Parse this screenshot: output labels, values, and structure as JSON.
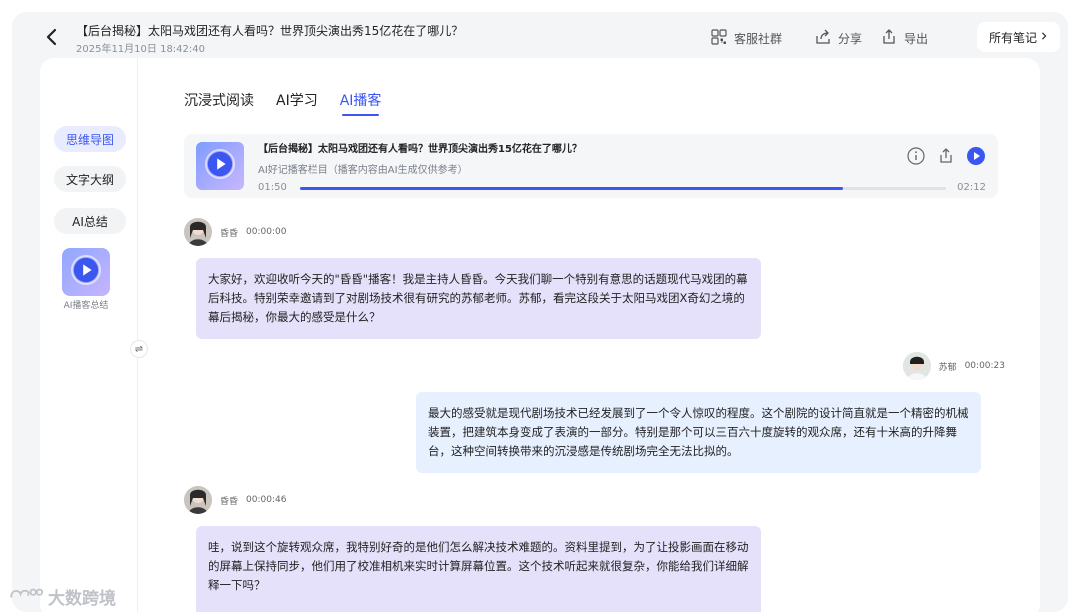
{
  "header": {
    "title": "【后台揭秘】太阳马戏团还有人看吗？世界顶尖演出秀15亿花在了哪儿？",
    "datetime": "2025年11月10日 18:42:40",
    "actions": {
      "community": "客服社群",
      "share": "分享",
      "export": "导出"
    },
    "all_notes": "所有笔记"
  },
  "sidebar": {
    "items": [
      {
        "label": "思维导图",
        "active": true
      },
      {
        "label": "文字大纲",
        "active": false
      },
      {
        "label": "AI总结",
        "active": false
      }
    ],
    "podcast_summary_label": "AI播客总结"
  },
  "tabs": [
    {
      "label": "沉浸式阅读",
      "active": false
    },
    {
      "label": "AI学习",
      "active": false
    },
    {
      "label": "AI播客",
      "active": true
    }
  ],
  "player": {
    "title": "【后台揭秘】太阳马戏团还有人看吗？世界顶尖演出秀15亿花在了哪儿？",
    "subtitle": "AI好记播客栏目（播客内容由AI生成仅供参考）",
    "current_time": "01:50",
    "duration": "02:12",
    "progress": 0.84
  },
  "messages": [
    {
      "speaker": "昏昏",
      "time": "00:00:00",
      "side": "left",
      "text": "大家好，欢迎收听今天的\"昏昏\"播客！我是主持人昏昏。今天我们聊一个特别有意思的话题现代马戏团的幕后科技。特别荣幸邀请到了对剧场技术很有研究的苏郁老师。苏郁，看完这段关于太阳马戏团X奇幻之境的幕后揭秘，你最大的感受是什么？"
    },
    {
      "speaker": "苏郁",
      "time": "00:00:23",
      "side": "right",
      "text": "最大的感受就是现代剧场技术已经发展到了一个令人惊叹的程度。这个剧院的设计简直就是一个精密的机械装置，把建筑本身变成了表演的一部分。特别是那个可以三百六十度旋转的观众席，还有十米高的升降舞台，这种空间转换带来的沉浸感是传统剧场完全无法比拟的。"
    },
    {
      "speaker": "昏昏",
      "time": "00:00:46",
      "side": "left",
      "text": "哇，说到这个旋转观众席，我特别好奇的是他们怎么解决技术难题的。资料里提到，为了让投影画面在移动的屏幕上保持同步，他们用了校准相机来实时计算屏幕位置。这个技术听起来就很复杂，你能给我们详细解释一下吗？"
    }
  ],
  "watermark": "大数跨境",
  "colors": {
    "accent": "#3b57f0",
    "host_bubble": "#e6e1fb",
    "guest_bubble": "#e7f0ff",
    "frame_bg": "#f4f5f7"
  }
}
